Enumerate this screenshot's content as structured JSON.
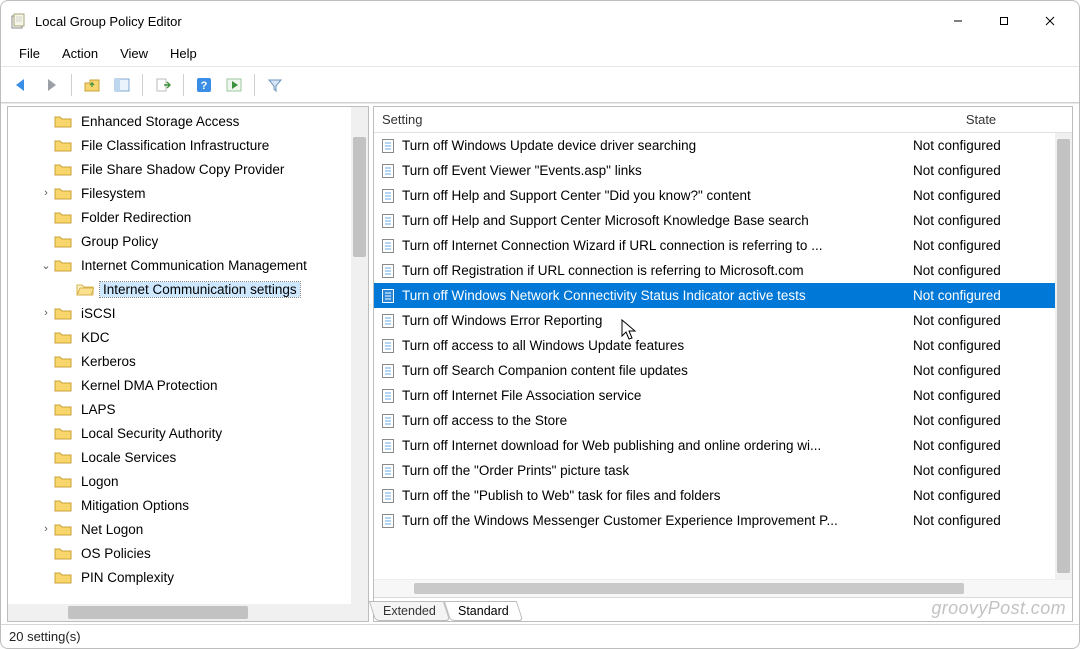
{
  "window": {
    "title": "Local Group Policy Editor"
  },
  "menubar": [
    "File",
    "Action",
    "View",
    "Help"
  ],
  "columns": {
    "setting": "Setting",
    "state": "State"
  },
  "tree": [
    {
      "label": "Enhanced Storage Access",
      "indent": 1,
      "exp": ""
    },
    {
      "label": "File Classification Infrastructure",
      "indent": 1,
      "exp": ""
    },
    {
      "label": "File Share Shadow Copy Provider",
      "indent": 1,
      "exp": ""
    },
    {
      "label": "Filesystem",
      "indent": 1,
      "exp": "›"
    },
    {
      "label": "Folder Redirection",
      "indent": 1,
      "exp": ""
    },
    {
      "label": "Group Policy",
      "indent": 1,
      "exp": ""
    },
    {
      "label": "Internet Communication Management",
      "indent": 1,
      "exp": "v"
    },
    {
      "label": "Internet Communication settings",
      "indent": 2,
      "exp": "",
      "selected": true,
      "open": true
    },
    {
      "label": "iSCSI",
      "indent": 1,
      "exp": "›"
    },
    {
      "label": "KDC",
      "indent": 1,
      "exp": ""
    },
    {
      "label": "Kerberos",
      "indent": 1,
      "exp": ""
    },
    {
      "label": "Kernel DMA Protection",
      "indent": 1,
      "exp": ""
    },
    {
      "label": "LAPS",
      "indent": 1,
      "exp": ""
    },
    {
      "label": "Local Security Authority",
      "indent": 1,
      "exp": ""
    },
    {
      "label": "Locale Services",
      "indent": 1,
      "exp": ""
    },
    {
      "label": "Logon",
      "indent": 1,
      "exp": ""
    },
    {
      "label": "Mitigation Options",
      "indent": 1,
      "exp": ""
    },
    {
      "label": "Net Logon",
      "indent": 1,
      "exp": "›"
    },
    {
      "label": "OS Policies",
      "indent": 1,
      "exp": ""
    },
    {
      "label": "PIN Complexity",
      "indent": 1,
      "exp": ""
    }
  ],
  "settings": [
    {
      "name": "Turn off Windows Update device driver searching",
      "state": "Not configured"
    },
    {
      "name": "Turn off Event Viewer \"Events.asp\" links",
      "state": "Not configured"
    },
    {
      "name": "Turn off Help and Support Center \"Did you know?\" content",
      "state": "Not configured"
    },
    {
      "name": "Turn off Help and Support Center Microsoft Knowledge Base search",
      "state": "Not configured"
    },
    {
      "name": "Turn off Internet Connection Wizard if URL connection is referring to ...",
      "state": "Not configured"
    },
    {
      "name": "Turn off Registration if URL connection is referring to Microsoft.com",
      "state": "Not configured"
    },
    {
      "name": "Turn off Windows Network Connectivity Status Indicator active tests",
      "state": "Not configured",
      "selected": true
    },
    {
      "name": "Turn off Windows Error Reporting",
      "state": "Not configured"
    },
    {
      "name": "Turn off access to all Windows Update features",
      "state": "Not configured"
    },
    {
      "name": "Turn off Search Companion content file updates",
      "state": "Not configured"
    },
    {
      "name": "Turn off Internet File Association service",
      "state": "Not configured"
    },
    {
      "name": "Turn off access to the Store",
      "state": "Not configured"
    },
    {
      "name": "Turn off Internet download for Web publishing and online ordering wi...",
      "state": "Not configured"
    },
    {
      "name": "Turn off the \"Order Prints\" picture task",
      "state": "Not configured"
    },
    {
      "name": "Turn off the \"Publish to Web\" task for files and folders",
      "state": "Not configured"
    },
    {
      "name": "Turn off the Windows Messenger Customer Experience Improvement P...",
      "state": "Not configured"
    }
  ],
  "tabs": {
    "extended": "Extended",
    "standard": "Standard"
  },
  "status": "20 setting(s)",
  "watermark": "groovyPost.com"
}
